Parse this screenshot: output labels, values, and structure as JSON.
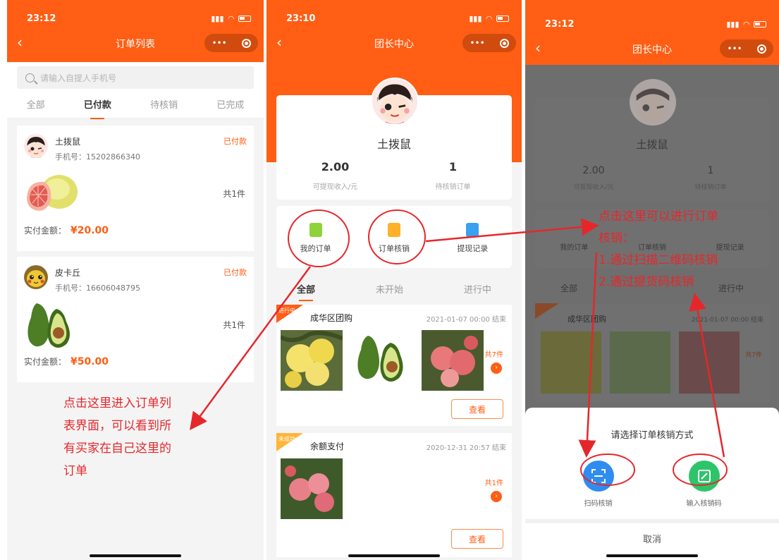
{
  "panel1": {
    "time": "23:12",
    "nav_title": "订单列表",
    "search_placeholder": "请输入自提人手机号",
    "tabs": [
      "全部",
      "已付款",
      "待核销",
      "已完成"
    ],
    "orders": [
      {
        "name": "土拨鼠",
        "phone": "手机号：15202866340",
        "status": "已付款",
        "count": "共1件",
        "total_label": "实付金额：",
        "total": "¥20.00"
      },
      {
        "name": "皮卡丘",
        "phone": "手机号：16606048795",
        "status": "已付款",
        "count": "共1件",
        "total_label": "实付金额：",
        "total": "¥50.00"
      }
    ],
    "annotation": [
      "点击这里进入订单列",
      "表界面，可以看到所",
      "有买家在自己这里的",
      "订单"
    ]
  },
  "panel2": {
    "time": "23:10",
    "nav_title": "团长中心",
    "user_name": "土拨鼠",
    "stats": [
      {
        "value": "2.00",
        "label": "可提现收入/元"
      },
      {
        "value": "1",
        "label": "待核销订单"
      }
    ],
    "menu": [
      {
        "label": "我的订单",
        "icon": "order-list-icon"
      },
      {
        "label": "订单核销",
        "icon": "verify-icon"
      },
      {
        "label": "提现记录",
        "icon": "withdraw-record-icon"
      }
    ],
    "tabs": [
      "全部",
      "未开始",
      "进行中"
    ],
    "groups": [
      {
        "badge": "进行中",
        "title": "成华区团购",
        "time": "2021-01-07 00:00 结束",
        "count": "共7件",
        "button": "查看"
      },
      {
        "badge": "未成功",
        "title": "余额支付",
        "time": "2020-12-31 20:57 结束",
        "count": "共1件",
        "button": "查看"
      }
    ]
  },
  "panel3": {
    "time": "23:12",
    "nav_title": "团长中心",
    "user_name": "土拨鼠",
    "stats": [
      {
        "value": "2.00",
        "label": "可提现收入/元"
      },
      {
        "value": "1",
        "label": "待核销订单"
      }
    ],
    "menu": [
      "我的订单",
      "订单核销",
      "提现记录"
    ],
    "tabs": [
      "全部",
      "进行中"
    ],
    "group_title": "成华区团购",
    "group_time": "2021-01-07 00:00 结束",
    "group_count": "共7件",
    "sheet_title": "请选择订单核销方式",
    "options": [
      {
        "label": "扫码核销",
        "icon": "scan-icon"
      },
      {
        "label": "输入核销码",
        "icon": "edit-icon"
      }
    ],
    "cancel": "取消",
    "annotation": [
      "点击这里可以进行订单",
      "核销：",
      "1.通过扫描二维码核销",
      "2.通过提货码核销"
    ]
  },
  "colors": {
    "accent": "#ff5e14",
    "annotation": "#e5272b"
  }
}
